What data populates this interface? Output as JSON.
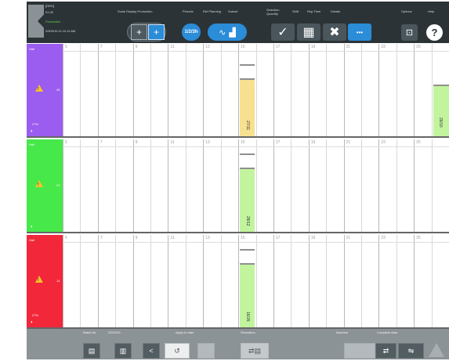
{
  "toolbar": {
    "info": [
      "[DRO]",
      "01 00",
      "Production",
      "2/5/2015 11:11:11 AM"
    ],
    "labels": [
      "Scale Display Production",
      "Periods",
      "Ref Planning",
      "Subset",
      "Selection Quantity",
      "Shift",
      "Rep.Time",
      "Details",
      "Options",
      "Help"
    ],
    "buttons": {
      "zoom_in": "+",
      "zoom_fit": "+",
      "time_circle": "1/2/3h",
      "check": "✓",
      "grid": "▦",
      "cross": "✖",
      "more": "•••",
      "options": "⊡",
      "help": "?"
    }
  },
  "grid": {
    "column_headers": [
      "5",
      "7",
      "9",
      "11",
      "13",
      "15",
      "17",
      "19",
      "21",
      "23",
      "25"
    ],
    "rows": [
      {
        "color": "#9b5cf0",
        "label": "Hall",
        "num": "28",
        "bottom_label": "27%",
        "task": {
          "color": "#f7e08f",
          "text": "27/11"
        },
        "task2": {
          "color": "#c2f49d",
          "text": "26/10"
        }
      },
      {
        "color": "#46e84a",
        "label": "Hall",
        "num": "22",
        "bottom_label": "",
        "task": {
          "color": "#c2f49d",
          "text": "28/12"
        }
      },
      {
        "color": "#f2273a",
        "label": "Hall",
        "num": "14",
        "bottom_label": "27%",
        "task": {
          "color": "#c2f49d",
          "text": "16/26"
        }
      }
    ]
  },
  "bottom": {
    "labels": [
      "Batch list",
      "2/5/2015",
      "Apply to date",
      "Simulation",
      "Machine",
      "Complete data"
    ],
    "buttons": [
      "▤",
      "▥",
      "<",
      "↺",
      "",
      "⇄",
      "⇋"
    ]
  }
}
